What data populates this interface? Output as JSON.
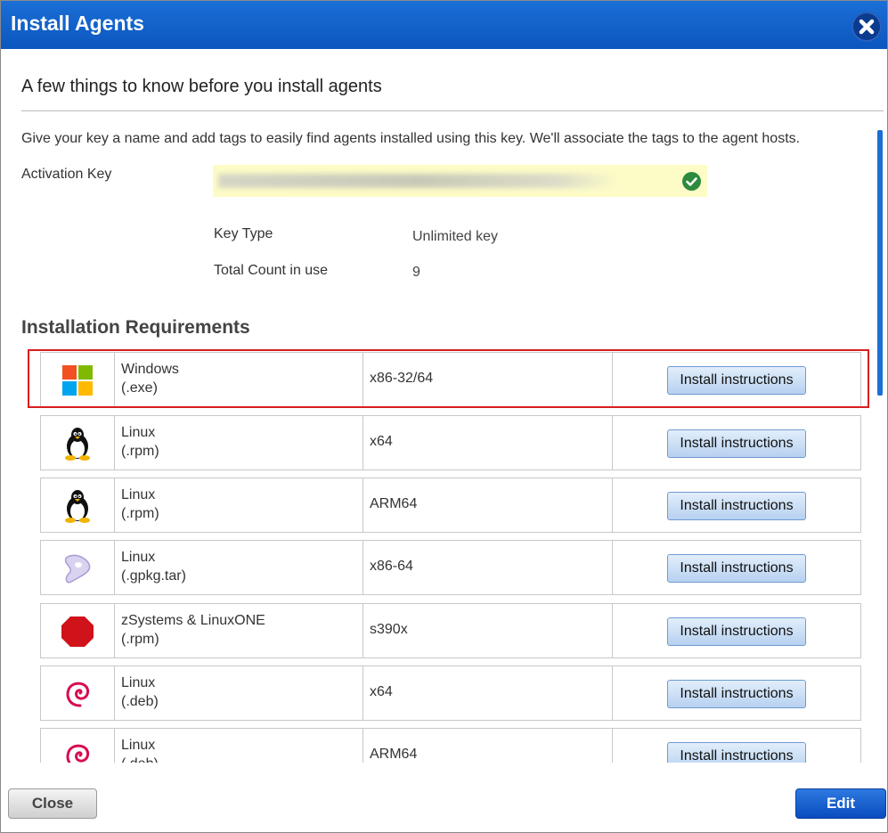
{
  "dialog": {
    "title": "Install Agents",
    "subtitle": "A few things to know before you install agents",
    "description": "Give your key a name and add tags to easily find agents installed using this key. We'll associate the tags to the agent hosts.",
    "activation_key_label": "Activation Key",
    "activation_key_status": "valid",
    "key_type_label": "Key Type",
    "key_type_value": "Unlimited key",
    "total_count_label": "Total Count in use",
    "total_count_value": "9",
    "section_title": "Installation Requirements",
    "close_button": "Close",
    "edit_button": "Edit",
    "highlight_color": "#d81e1e",
    "accent_color": "#0b56bf"
  },
  "agents": [
    {
      "icon": "windows-icon",
      "os": "Windows",
      "pkg": "(.exe)",
      "arch": "x86-32/64",
      "button": "Install instructions"
    },
    {
      "icon": "linux-tux-icon",
      "os": "Linux",
      "pkg": "(.rpm)",
      "arch": "x64",
      "button": "Install instructions"
    },
    {
      "icon": "linux-tux-icon",
      "os": "Linux",
      "pkg": "(.rpm)",
      "arch": "ARM64",
      "button": "Install instructions"
    },
    {
      "icon": "gentoo-icon",
      "os": "Linux",
      "pkg": "(.gpkg.tar)",
      "arch": "x86-64",
      "button": "Install instructions"
    },
    {
      "icon": "zlinux-icon",
      "os": "zSystems & LinuxONE",
      "pkg": "(.rpm)",
      "arch": "s390x",
      "button": "Install instructions"
    },
    {
      "icon": "debian-icon",
      "os": "Linux",
      "pkg": "(.deb)",
      "arch": "x64",
      "button": "Install instructions"
    },
    {
      "icon": "debian-icon",
      "os": "Linux",
      "pkg": "(.deb)",
      "arch": "ARM64",
      "button": "Install instructions"
    }
  ]
}
